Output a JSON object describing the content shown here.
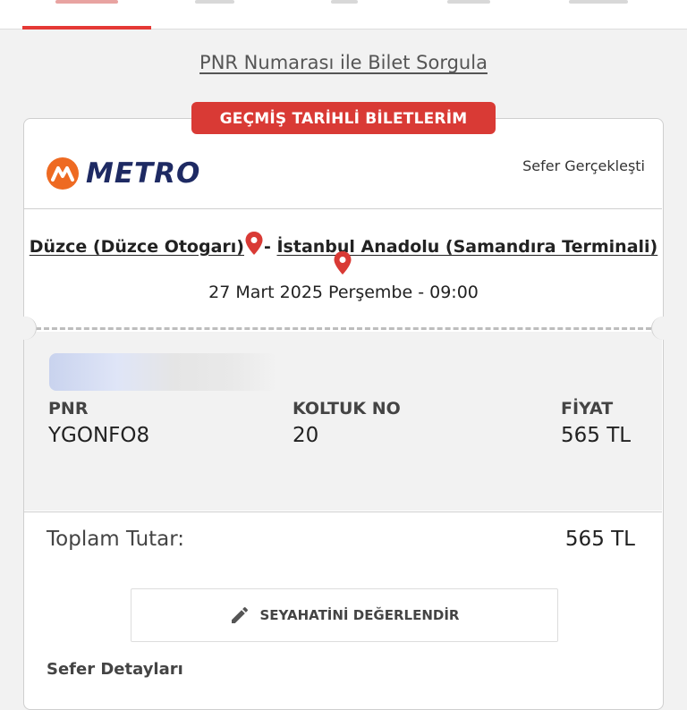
{
  "search": {
    "pnr_link": "PNR Numarası ile Bilet Sorgula"
  },
  "ticket": {
    "section_badge": "GEÇMİŞ TARİHLİ BİLETLERİM",
    "brand": "METRO",
    "status": "Sefer Gerçekleşti",
    "route": {
      "from": "Düzce (Düzce Otogarı)",
      "separator": "-",
      "to": "İstanbul Anadolu (Samandıra Terminali)"
    },
    "date": "27 Mart 2025 Perşembe - 09:00",
    "fields": {
      "pnr_label": "PNR",
      "pnr_value": "YGONFO8",
      "seat_label": "KOLTUK NO",
      "seat_value": "20",
      "price_label": "FİYAT",
      "price_value": "565 TL"
    },
    "total_label": "Toplam Tutar:",
    "total_value": "565 TL",
    "rate_button": "SEYAHATİNİ DEĞERLENDİR",
    "details_heading": "Sefer Detayları"
  },
  "colors": {
    "accent": "#d93a35",
    "brand_orange": "#ee6a22",
    "brand_navy": "#1e2a63"
  }
}
